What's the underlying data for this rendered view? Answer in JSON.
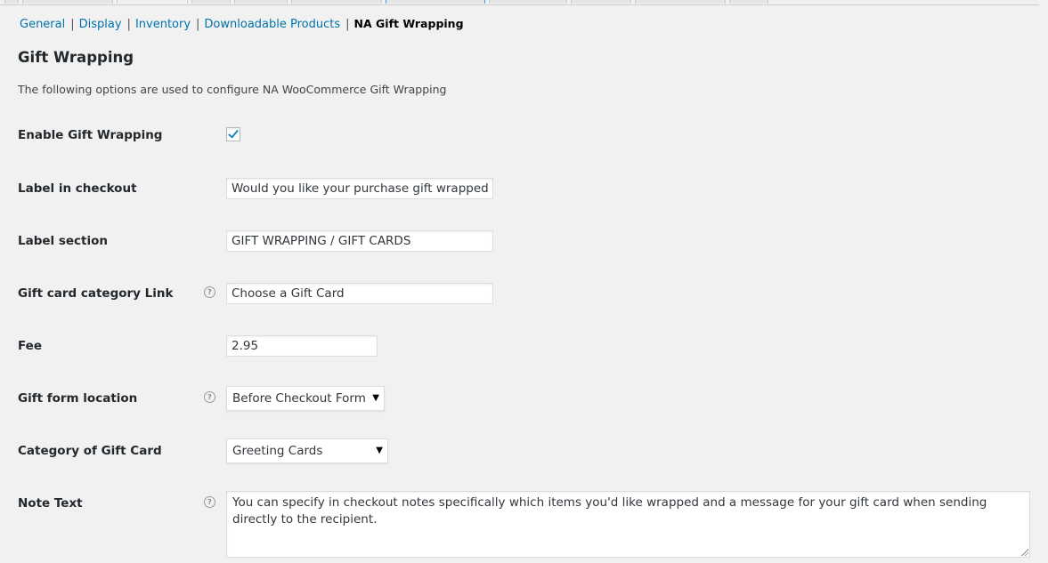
{
  "nav": {
    "links": [
      "General",
      "Display",
      "Inventory",
      "Downloadable Products"
    ],
    "current": "NA Gift Wrapping"
  },
  "section": {
    "title": "Gift Wrapping",
    "description": "The following options are used to configure NA WooCommerce Gift Wrapping"
  },
  "fields": {
    "enable": {
      "label": "Enable Gift Wrapping",
      "checked": true
    },
    "label_checkout": {
      "label": "Label in checkout",
      "value": "Would you like your purchase gift wrapped f"
    },
    "label_section": {
      "label": "Label section",
      "value": "GIFT WRAPPING / GIFT CARDS"
    },
    "gift_card_link": {
      "label": "Gift card category Link",
      "value": "Choose a Gift Card"
    },
    "fee": {
      "label": "Fee",
      "value": "2.95"
    },
    "form_location": {
      "label": "Gift form location",
      "selected": "Before Checkout Form"
    },
    "gift_category": {
      "label": "Category of Gift Card",
      "selected": "Greeting Cards"
    },
    "note_text": {
      "label": "Note Text",
      "value": "You can specify in checkout notes specifically which items you'd like wrapped and a message for your gift card when sending directly to the recipient."
    }
  },
  "icons": {
    "help": "question-circle-icon",
    "dropdown": "triangle-down-icon",
    "check": "checkmark-icon"
  },
  "colors": {
    "link": "#0073aa",
    "checkmark": "#1e8cbe",
    "background": "#f1f1f1"
  }
}
